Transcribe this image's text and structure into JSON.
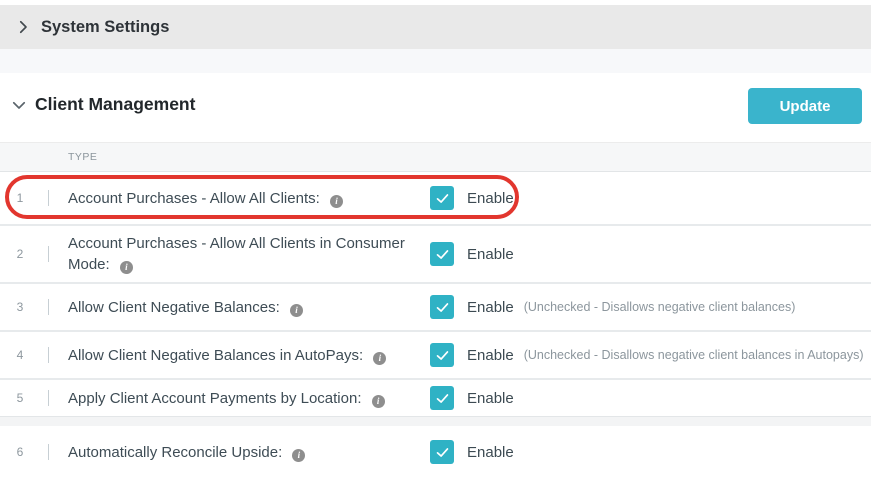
{
  "colors": {
    "accent_teal": "#35B3C9",
    "annotation_red": "#E2362E",
    "system_bar_bg": "#E9E9E9"
  },
  "sections": {
    "system_settings": {
      "title": "System Settings",
      "state": "collapsed"
    },
    "client_management": {
      "title": "Client Management",
      "state": "expanded",
      "update_button_label": "Update",
      "table": {
        "type_header": "TYPE",
        "rows": [
          {
            "num": "1",
            "label": "Account Purchases - Allow All Clients:",
            "has_info_icon": true,
            "checked": true,
            "checkbox_label": "Enable",
            "note": "",
            "annotated": true
          },
          {
            "num": "2",
            "label": "Account Purchases - Allow All Clients in Consumer Mode:",
            "has_info_icon": true,
            "checked": true,
            "checkbox_label": "Enable",
            "note": "",
            "annotated": false
          },
          {
            "num": "3",
            "label": "Allow Client Negative Balances:",
            "has_info_icon": true,
            "checked": true,
            "checkbox_label": "Enable",
            "note": "(Unchecked - Disallows negative client balances)",
            "annotated": false
          },
          {
            "num": "4",
            "label": "Allow Client Negative Balances in AutoPays:",
            "has_info_icon": true,
            "checked": true,
            "checkbox_label": "Enable",
            "note": "(Unchecked - Disallows negative client balances in Autopays)",
            "annotated": false
          },
          {
            "num": "5",
            "label": "Apply Client Account Payments by Location:",
            "has_info_icon": true,
            "checked": true,
            "checkbox_label": "Enable",
            "note": "",
            "annotated": false
          },
          {
            "num": "6",
            "label": "Automatically Reconcile Upside:",
            "has_info_icon": true,
            "checked": true,
            "checkbox_label": "Enable",
            "note": "",
            "annotated": false
          }
        ]
      }
    }
  }
}
